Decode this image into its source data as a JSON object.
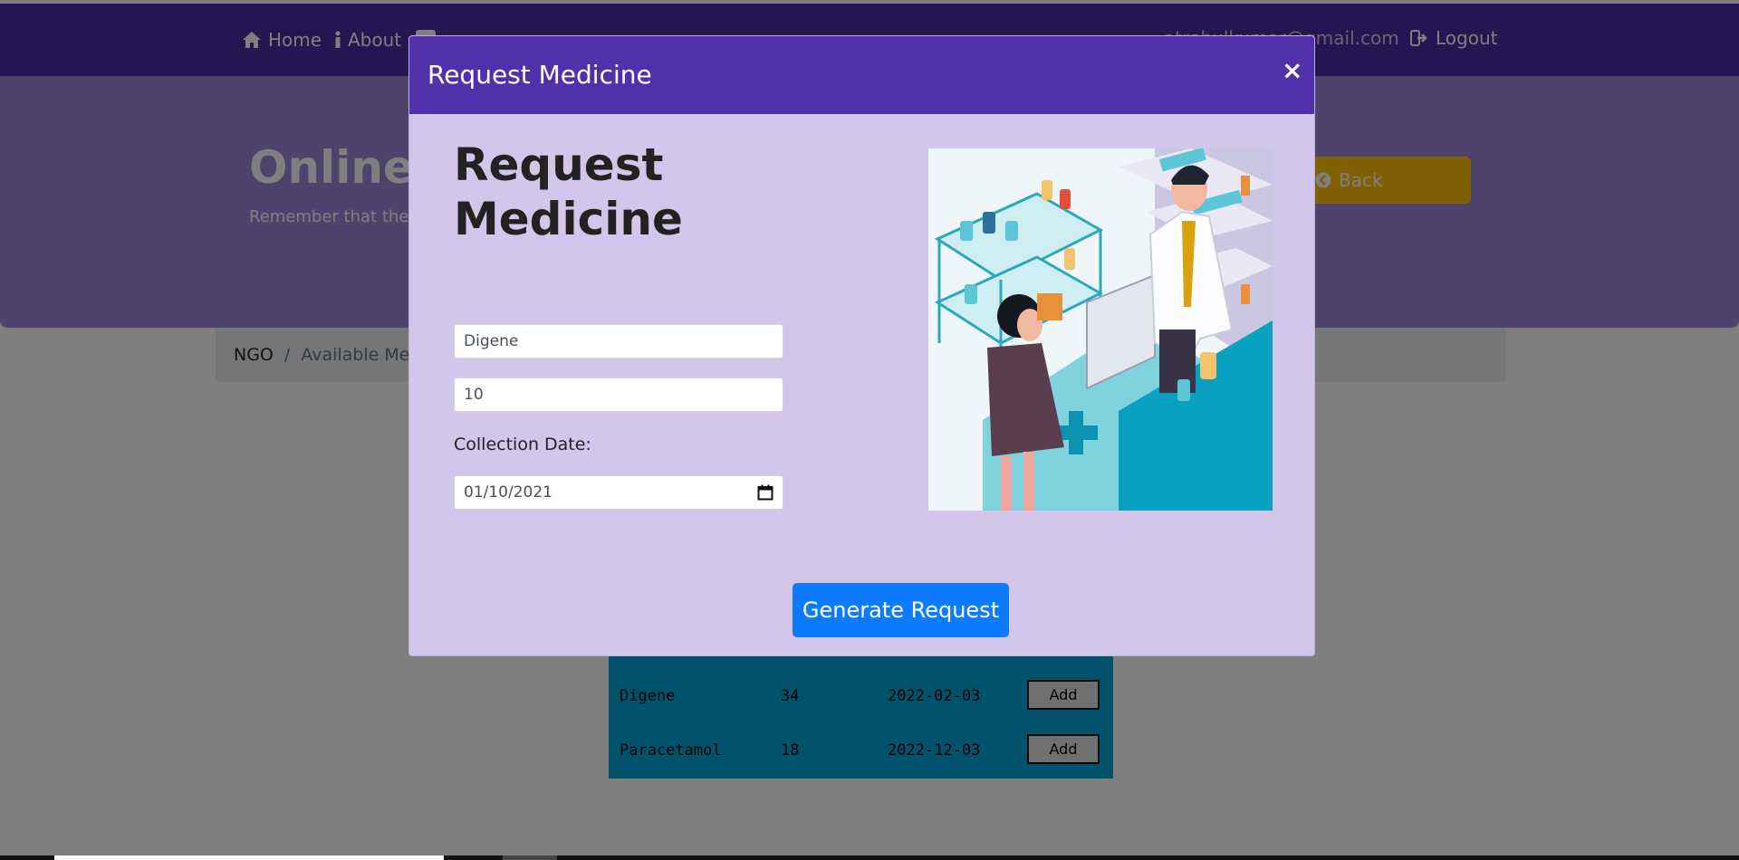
{
  "navbar": {
    "home_label": "Home",
    "about_label": "About",
    "email": "atrahulkumar@gmail.com",
    "logout_label": "Logout",
    "bg_color": "#4a2aa3"
  },
  "hero": {
    "title": "Online U",
    "subtitle": "Remember that the",
    "back_label": "Back"
  },
  "breadcrumb": {
    "items": [
      "NGO",
      "Available Med"
    ]
  },
  "medicines_table": {
    "rows": [
      {
        "name": "Digene",
        "qty": "34",
        "date": "2022-02-03",
        "action": "Add"
      },
      {
        "name": "Paracetamol",
        "qty": "18",
        "date": "2022-12-03",
        "action": "Add"
      }
    ]
  },
  "modal": {
    "title": "Request Medicine",
    "close_symbol": "×",
    "heading": "Request Medicine",
    "name_value": "Digene",
    "quantity_value": "10",
    "date_label": "Collection Date:",
    "date_value": "01/10/2021",
    "submit_label": "Generate Request",
    "header_color": "#522fab",
    "button_color": "#0d7bff"
  }
}
